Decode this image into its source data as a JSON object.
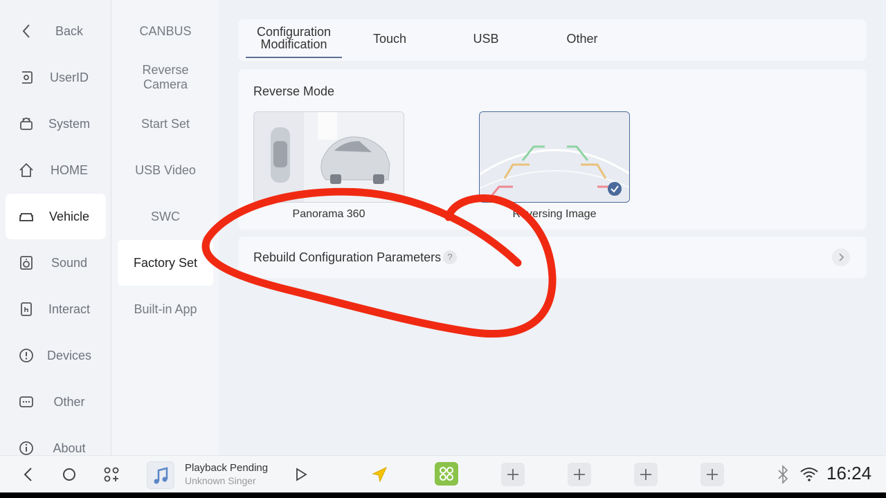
{
  "sidebar": {
    "items": [
      {
        "label": "Back",
        "icon": "back-arrow-icon"
      },
      {
        "label": "UserID",
        "icon": "user-id-icon"
      },
      {
        "label": "System",
        "icon": "android-icon"
      },
      {
        "label": "HOME",
        "icon": "home-icon"
      },
      {
        "label": "Vehicle",
        "icon": "car-icon",
        "active": true
      },
      {
        "label": "Sound",
        "icon": "speaker-icon"
      },
      {
        "label": "Interact",
        "icon": "touch-icon"
      },
      {
        "label": "Devices",
        "icon": "alert-icon"
      },
      {
        "label": "Other",
        "icon": "more-icon"
      },
      {
        "label": "About",
        "icon": "info-icon"
      }
    ]
  },
  "subnav": {
    "items": [
      {
        "label": "CANBUS"
      },
      {
        "label": "Reverse Camera"
      },
      {
        "label": "Start Set"
      },
      {
        "label": "USB Video"
      },
      {
        "label": "SWC"
      },
      {
        "label": "Factory Set",
        "active": true
      },
      {
        "label": "Built-in App"
      }
    ]
  },
  "tabs": [
    {
      "label": "Configuration Modification",
      "active": true
    },
    {
      "label": "Touch"
    },
    {
      "label": "USB"
    },
    {
      "label": "Other"
    }
  ],
  "reverse_mode": {
    "title": "Reverse Mode",
    "options": [
      {
        "label": "Panorama 360",
        "selected": false
      },
      {
        "label": "Reversing Image",
        "selected": true
      }
    ]
  },
  "rebuild": {
    "label": "Rebuild Configuration Parameters",
    "help": "?"
  },
  "bottombar": {
    "playback_title": "Playback Pending",
    "playback_sub": "Unknown Singer",
    "clock": "16:24"
  },
  "colors": {
    "annotation": "#f02a12",
    "accent": "#4a6a9c",
    "apps_green": "#8bc34a"
  }
}
